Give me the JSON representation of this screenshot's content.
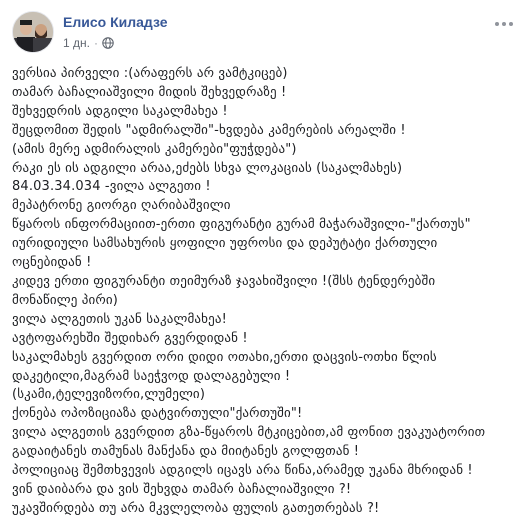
{
  "post": {
    "author": "Елисо Киладзе",
    "time": "1 дн.",
    "privacy_icon": "globe-icon",
    "menu_icon": "more-options-icon",
    "lines": [
      "ვერსია პირველი :(არაფერს არ ვამტკიცებ)",
      "თამარ ბაჩალიაშვილი მიდის შეხვედრაზე !",
      "შეხვედრის ადგილი საკალმახეა !",
      "შეცდომით შედის \"ადმირალში\"-ხვდება კამერების არეალში !",
      "(ამის მერე ადმირალის კამერები\"ფუჭდება\")",
      "რაკი ეს ის ადგილი არაა,ეძებს სხვა ლოკაციას (საკალმახეს)",
      "84.03.34.034 -ვილა ალგეთი !",
      "მეპატრონე გიორგი ღარიბაშვილი",
      "წყაროს ინფორმაციით-ერთი ფიგურანტი გურამ მაჭარაშვილი-\"ქართუს\"",
      "იურიდიული სამსახურის ყოფილი უფროსი და დეპუტატი ქართული",
      "ოცნებიდან !",
      "კიდევ ერთი ფიგურანტი თეიმურაზ ჯავახიშვილი !(შსს ტენდერებში",
      "მონაწილე პირი)",
      "ვილა ალგეთის უკან საკალმახეა!",
      "ავტოფარეხში შედიხარ გვერდიდან !",
      "საკალმახეს გვერდით ორი დიდი ოთახი,ერთი დაცვის-ოთხი წლის",
      "დაკეტილი,მაგრამ საეჭვოდ დალაგებული !",
      "(სკამი,ტელევიზორი,ლუმელი)",
      "ქონება ოპოზიციაზა დატვირთული\"ქართუში\"!",
      "ვილა ალგეთის გვერდით გზა-წყაროს მტკიცებით,ამ ფონით ევაკუატორით",
      "გადაიტანეს თამუნას მანქანა და მიიტანეს გოლფთან !",
      "პოლიციაც შემთხვევის ადგილს იცავს არა წინა,არამედ უკანა მხრიდან !",
      "ვინ დაიბარა და ვის შეხვდა თამარ ბაჩალიაშვილი ?!",
      "უკავშირდება თუ არა მკვლელობა ფულის გათეთრებას ?!"
    ]
  }
}
